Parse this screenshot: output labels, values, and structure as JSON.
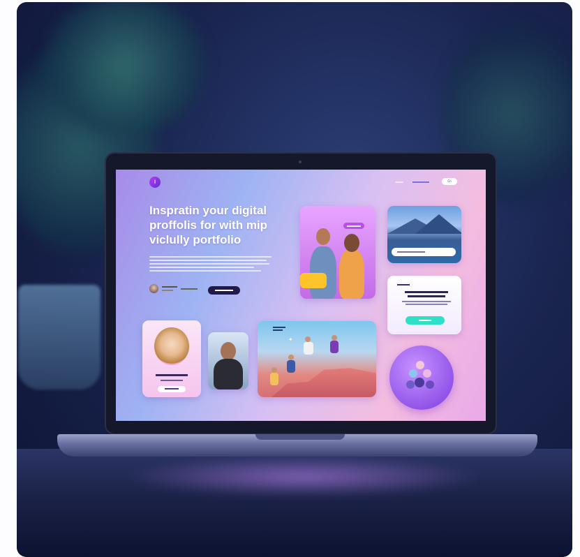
{
  "screen": {
    "headline": "Inspratin your digital proffolis for with mip viclully portfolio",
    "nav_pill": "Cn"
  },
  "colors": {
    "accent": "#b74fe8",
    "cta": "#1f1a4a",
    "contact_button": "#2ee0c7",
    "note": "#ffc42a"
  },
  "icons": [
    "logo-icon",
    "avatar-icon",
    "bird-icon"
  ]
}
